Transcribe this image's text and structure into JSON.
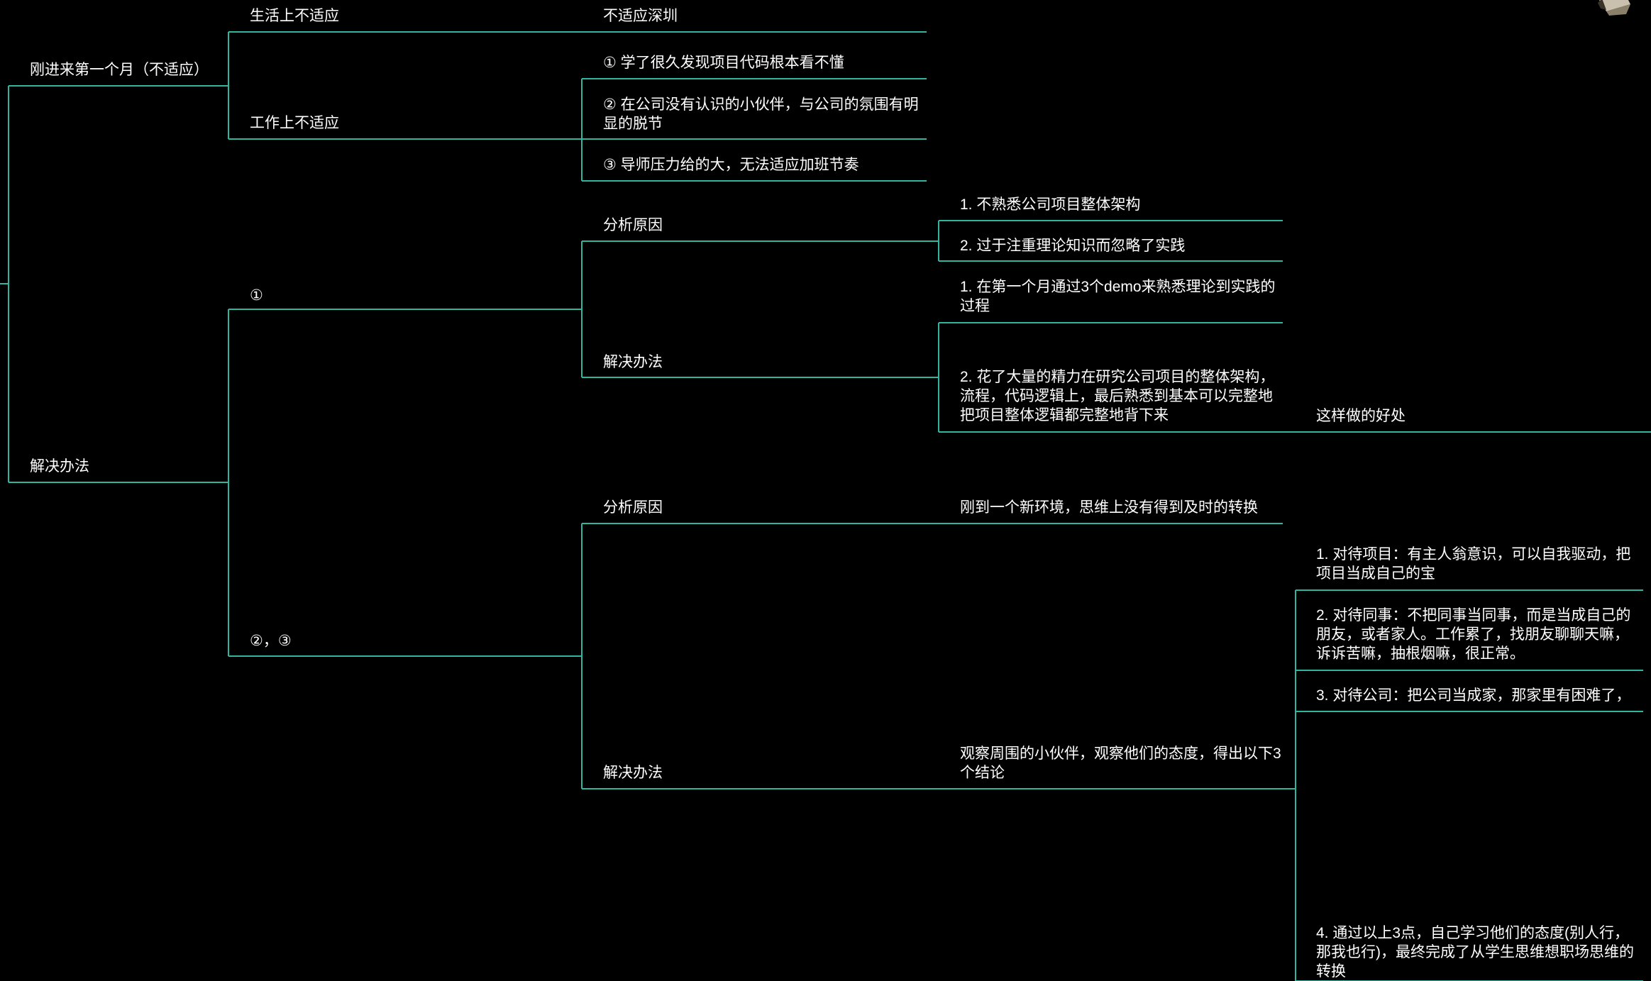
{
  "colors": {
    "background": "#000000",
    "edge": "#2fb5a0",
    "text": "#ffffff"
  },
  "corner_icon": "pencil-icon",
  "mindmap": {
    "branch_first_month": {
      "label": "刚进来第一个月（不适应）",
      "life": {
        "label": "生活上不适应",
        "detail": "不适应深圳"
      },
      "work": {
        "label": "工作上不适应",
        "items": [
          "① 学了很久发现项目代码根本看不懂",
          "② 在公司没有认识的小伙伴，与公司的氛围有明显的脱节",
          "③ 导师压力给的大，无法适应加班节奏"
        ]
      }
    },
    "branch_solution": {
      "label": "解决办法",
      "item1": {
        "label": "①",
        "cause": {
          "label": "分析原因",
          "items": [
            "1. 不熟悉公司项目整体架构",
            "2. 过于注重理论知识而忽略了实践"
          ]
        },
        "solution": {
          "label": "解决办法",
          "items": [
            "1. 在第一个月通过3个demo来熟悉理论到实践的过程",
            "2. 花了大量的精力在研究公司项目的整体架构，流程，代码逻辑上，最后熟悉到基本可以完整地把项目整体逻辑都完整地背下来"
          ],
          "benefit": "这样做的好处"
        }
      },
      "item23": {
        "label": "②，③",
        "cause": {
          "label": "分析原因",
          "detail": "刚到一个新环境，思维上没有得到及时的转换"
        },
        "solution": {
          "label": "解决办法",
          "observe": "观察周围的小伙伴，观察他们的态度，得出以下3个结论",
          "conclusions": [
            "1. 对待项目：有主人翁意识，可以自我驱动，把项目当成自己的宝",
            "2. 对待同事：不把同事当同事，而是当成自己的朋友，或者家人。工作累了，找朋友聊聊天嘛，诉诉苦嘛，抽根烟嘛，很正常。",
            "3. 对待公司：把公司当成家，那家里有困难了，",
            "4. 通过以上3点，自己学习他们的态度(别人行，那我也行)，最终完成了从学生思维想职场思维的转换"
          ]
        }
      }
    }
  }
}
